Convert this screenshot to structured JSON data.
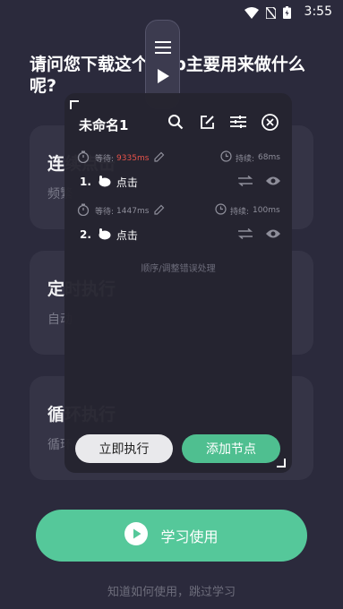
{
  "status": {
    "time": "3:55"
  },
  "question": "请问您下载这个App主要用来做什么呢?",
  "cards": [
    {
      "title": "连续点击",
      "subtitle": "频繁"
    },
    {
      "title": "定时执行",
      "subtitle": "自动"
    },
    {
      "title": "循环执行",
      "subtitle": "循环"
    }
  ],
  "panel": {
    "title": "未命名1",
    "steps": [
      {
        "num": "1.",
        "wait_label": "等待:",
        "wait_value": "9335ms",
        "dur_label": "持续:",
        "dur_value": "68ms",
        "action": "点击"
      },
      {
        "num": "2.",
        "wait_label": "等待:",
        "wait_value": "1447ms",
        "dur_label": "持续:",
        "dur_value": "100ms",
        "action": "点击"
      }
    ],
    "hint": "顺序/调整错误处理",
    "exec_button": "立即执行",
    "add_button": "添加节点"
  },
  "learn_button": "学习使用",
  "skip_text": "知道如何使用，跳过学习",
  "colors": {
    "accent": "#55c89a",
    "background": "#2b2a3c",
    "warn": "#e8534a"
  }
}
